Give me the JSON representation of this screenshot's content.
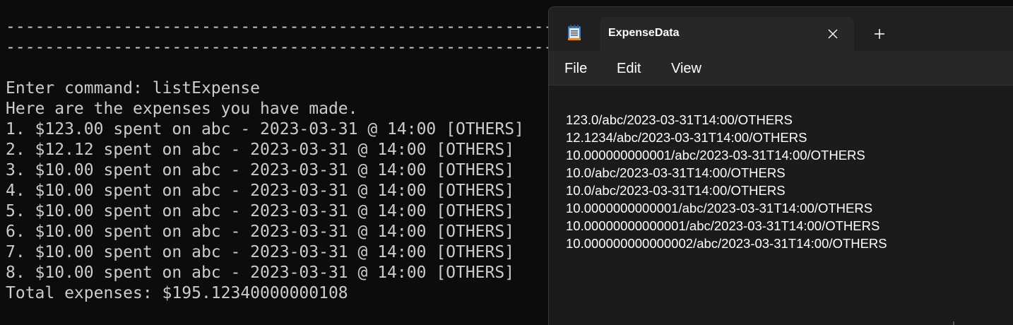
{
  "terminal": {
    "separator_1": "-----------------------------------------------------------------------------------------------",
    "separator_2": "-----------------------------------------------------------------------------------------------",
    "command_line": "Enter command: listExpense",
    "header_line": "Here are the expenses you have made.",
    "expense_lines": [
      "1. $123.00 spent on abc - 2023-03-31 @ 14:00 [OTHERS]",
      "2. $12.12 spent on abc - 2023-03-31 @ 14:00 [OTHERS]",
      "3. $10.00 spent on abc - 2023-03-31 @ 14:00 [OTHERS]",
      "4. $10.00 spent on abc - 2023-03-31 @ 14:00 [OTHERS]",
      "5. $10.00 spent on abc - 2023-03-31 @ 14:00 [OTHERS]",
      "6. $10.00 spent on abc - 2023-03-31 @ 14:00 [OTHERS]",
      "7. $10.00 spent on abc - 2023-03-31 @ 14:00 [OTHERS]",
      "8. $10.00 spent on abc - 2023-03-31 @ 14:00 [OTHERS]"
    ],
    "total_line": "Total expenses: $195.12340000000108"
  },
  "notepad": {
    "app_icon": "notepad-icon",
    "tab_title": "ExpenseData",
    "close_icon": "close-icon",
    "new_tab_icon": "plus-icon",
    "menu": {
      "file": "File",
      "edit": "Edit",
      "view": "View"
    },
    "lines": [
      "123.0/abc/2023-03-31T14:00/OTHERS",
      "12.1234/abc/2023-03-31T14:00/OTHERS",
      "10.000000000001/abc/2023-03-31T14:00/OTHERS",
      "10.0/abc/2023-03-31T14:00/OTHERS",
      "10.0/abc/2023-03-31T14:00/OTHERS",
      "10.0000000000001/abc/2023-03-31T14:00/OTHERS",
      "10.00000000000001/abc/2023-03-31T14:00/OTHERS",
      "10.000000000000002/abc/2023-03-31T14:00/OTHERS"
    ]
  },
  "colors": {
    "terminal_background": "#0c0c0c",
    "terminal_text": "#cccccc",
    "notepad_titlebar": "#202020",
    "notepad_tab": "#272727",
    "notepad_editor": "#1b1b1b",
    "notepad_text": "#ffffff"
  }
}
